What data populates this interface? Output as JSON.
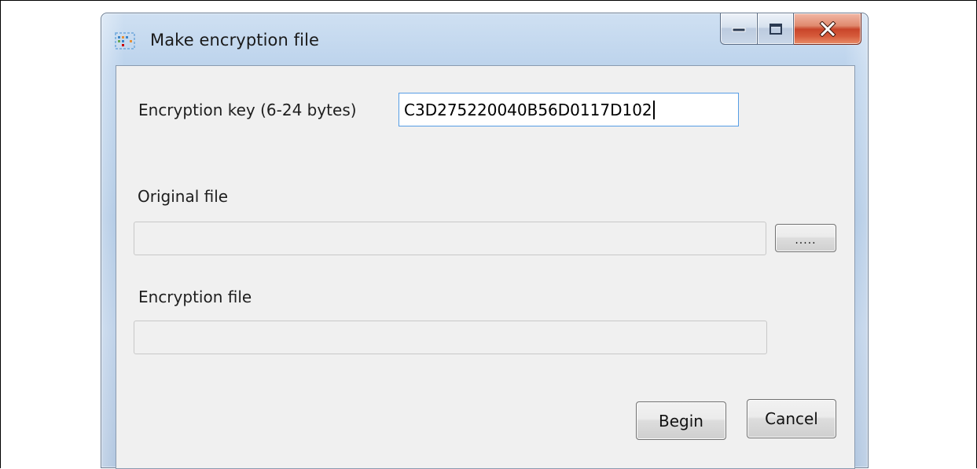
{
  "window": {
    "title": "Make encryption file",
    "icon": "app-grid-icon",
    "controls": [
      "minimize-icon",
      "maximize-icon",
      "close-icon"
    ]
  },
  "form": {
    "key_label": "Encryption key (6-24 bytes)",
    "key_value": "C3D275220040B56D0117D102",
    "original_label": "Original file",
    "original_value": "",
    "browse_label": ".....",
    "encryption_label": "Encryption file",
    "encryption_value": ""
  },
  "buttons": {
    "begin": "Begin",
    "cancel": "Cancel"
  },
  "colors": {
    "close_button": "#c8452a",
    "client_background": "#f0f0f0",
    "focus_border": "#569de5"
  }
}
